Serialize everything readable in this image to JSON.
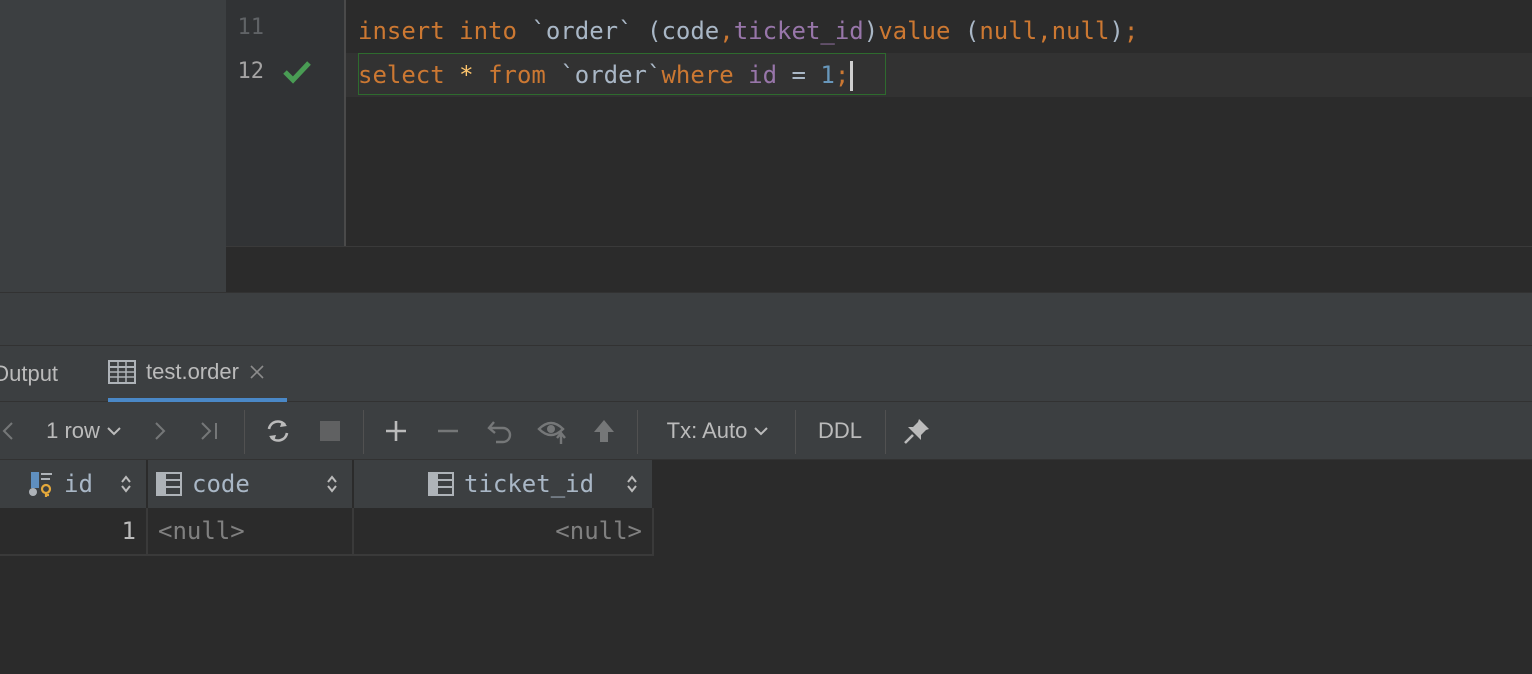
{
  "editor": {
    "lines": [
      {
        "number": "11",
        "tokens": [
          {
            "text": "insert",
            "cls": "kw"
          },
          {
            "text": " ",
            "cls": "id"
          },
          {
            "text": "into",
            "cls": "kw"
          },
          {
            "text": " `order` ",
            "cls": "id"
          },
          {
            "text": "(",
            "cls": "paren"
          },
          {
            "text": "code",
            "cls": "id"
          },
          {
            "text": ",",
            "cls": "punct"
          },
          {
            "text": "ticket_id",
            "cls": "col"
          },
          {
            "text": ")",
            "cls": "paren"
          },
          {
            "text": "value",
            "cls": "kw"
          },
          {
            "text": " (",
            "cls": "paren"
          },
          {
            "text": "null",
            "cls": "kw"
          },
          {
            "text": ",",
            "cls": "punct"
          },
          {
            "text": "null",
            "cls": "kw"
          },
          {
            "text": ")",
            "cls": "paren"
          },
          {
            "text": ";",
            "cls": "punct"
          }
        ]
      },
      {
        "number": "12",
        "tokens": [
          {
            "text": "select",
            "cls": "kw"
          },
          {
            "text": " ",
            "cls": "id"
          },
          {
            "text": "*",
            "cls": "star"
          },
          {
            "text": " ",
            "cls": "id"
          },
          {
            "text": "from",
            "cls": "kw"
          },
          {
            "text": " `order`",
            "cls": "id"
          },
          {
            "text": "where",
            "cls": "kw"
          },
          {
            "text": " ",
            "cls": "id"
          },
          {
            "text": "id",
            "cls": "col"
          },
          {
            "text": " = ",
            "cls": "id"
          },
          {
            "text": "1",
            "cls": "num"
          },
          {
            "text": ";",
            "cls": "punct"
          }
        ]
      }
    ],
    "status_icon": "check-icon",
    "colors": {
      "keyword": "#cc7832",
      "column": "#9876aa",
      "number": "#6897bb",
      "check": "#499c54"
    }
  },
  "tabs": {
    "output_label": "Output",
    "result_label": "test.order",
    "active_color": "#4a88c7"
  },
  "toolbar": {
    "rows_label": "1 row",
    "tx_label": "Tx: Auto",
    "ddl_label": "DDL"
  },
  "grid": {
    "columns": [
      {
        "label": "id",
        "icon": "primary-key-column-icon"
      },
      {
        "label": "code",
        "icon": "column-icon"
      },
      {
        "label": "ticket_id",
        "icon": "column-icon"
      }
    ],
    "rows": [
      {
        "id": "1",
        "code": "<null>",
        "ticket_id": "<null>"
      }
    ]
  }
}
